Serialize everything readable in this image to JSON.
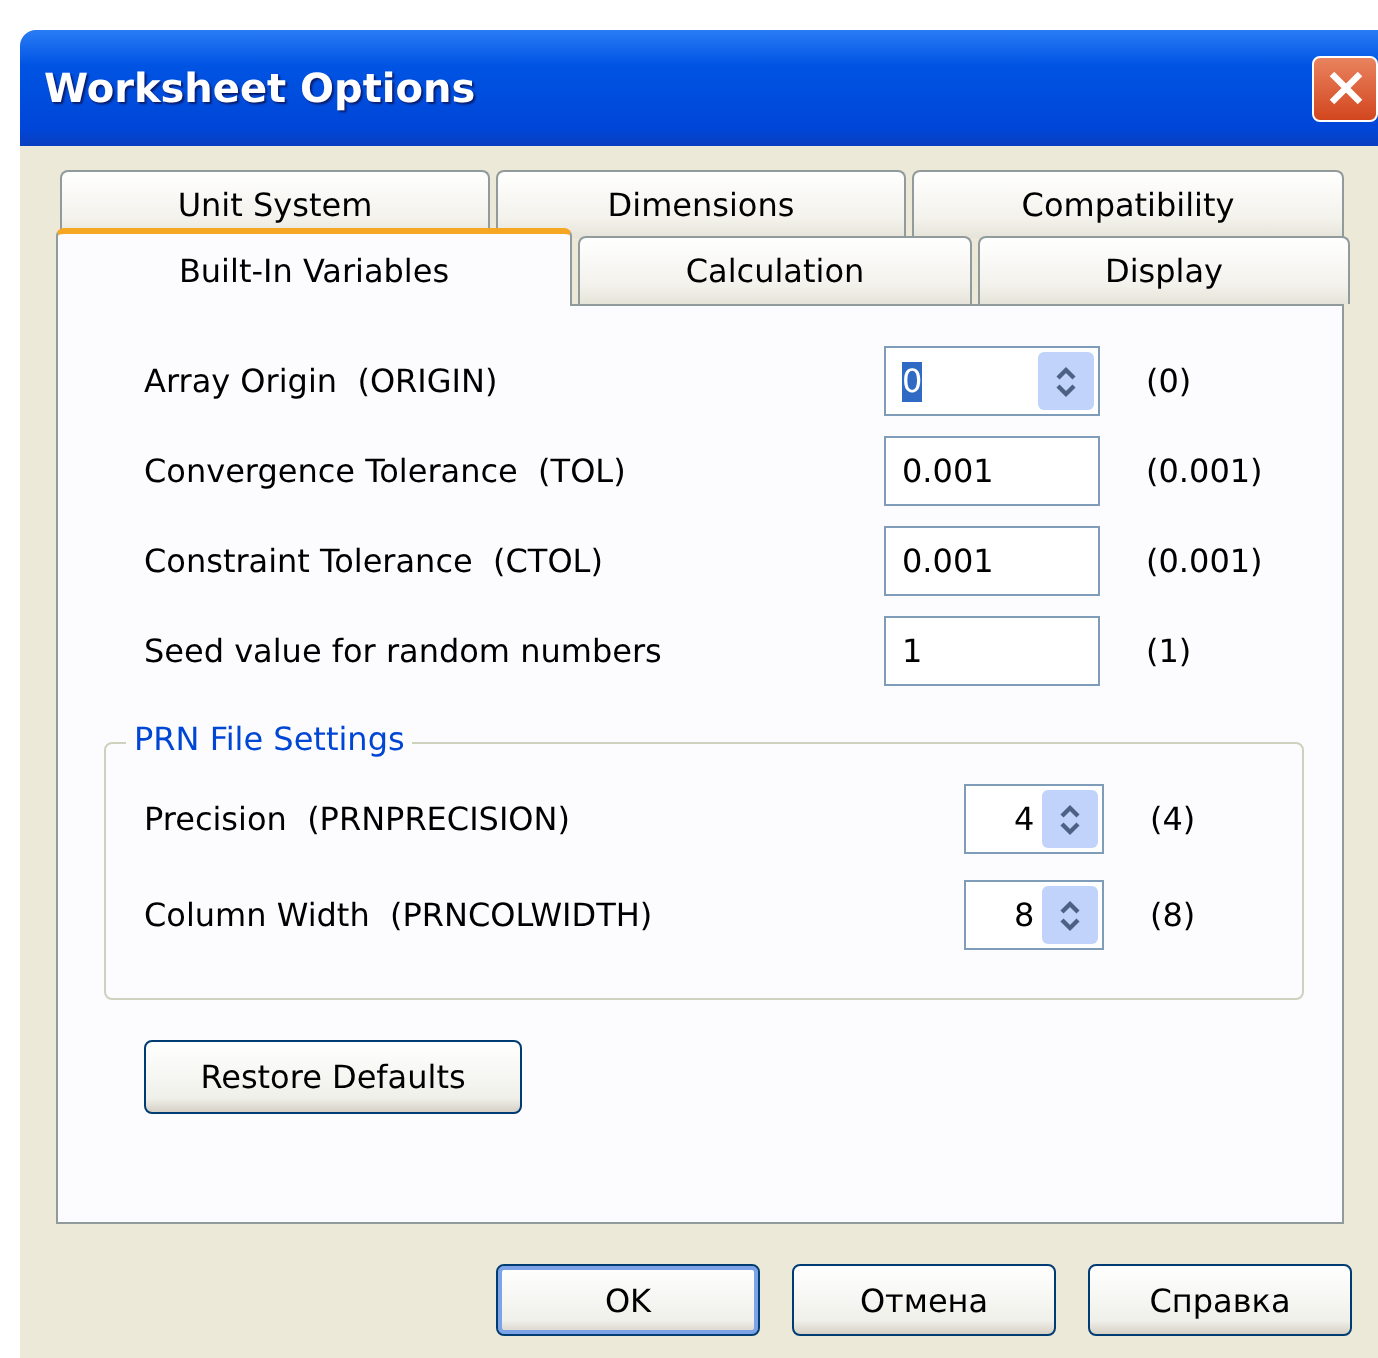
{
  "window": {
    "title": "Worksheet Options"
  },
  "tab_rows": [
    {
      "tabs": [
        {
          "label": "Unit System",
          "selected": false
        },
        {
          "label": "Dimensions",
          "selected": false
        },
        {
          "label": "Compatibility",
          "selected": false
        }
      ]
    },
    {
      "tabs": [
        {
          "label": "Built-In Variables",
          "selected": true
        },
        {
          "label": "Calculation",
          "selected": false
        },
        {
          "label": "Display",
          "selected": false
        }
      ]
    }
  ],
  "variables": [
    {
      "label": "Array Origin  (ORIGIN)",
      "kind": "spinner",
      "value": "0",
      "text_selected": true,
      "default": "(0)"
    },
    {
      "label": "Convergence Tolerance  (TOL)",
      "kind": "text",
      "value": "0.001",
      "text_selected": false,
      "default": "(0.001)"
    },
    {
      "label": "Constraint Tolerance  (CTOL)",
      "kind": "text",
      "value": "0.001",
      "text_selected": false,
      "default": "(0.001)"
    },
    {
      "label": "Seed value for random numbers",
      "kind": "text",
      "value": "1",
      "text_selected": false,
      "default": "(1)"
    }
  ],
  "prn_group": {
    "title": "PRN File Settings",
    "rows": [
      {
        "label": "Precision  (PRNPRECISION)",
        "kind": "spinner",
        "value": "4",
        "text_selected": false,
        "default": "(4)"
      },
      {
        "label": "Column Width  (PRNCOLWIDTH)",
        "kind": "spinner",
        "value": "8",
        "text_selected": false,
        "default": "(8)"
      }
    ]
  },
  "restore_button": "Restore Defaults",
  "buttons": [
    {
      "label": "OK",
      "default": true
    },
    {
      "label": "Отмена",
      "default": false
    },
    {
      "label": "Справка",
      "default": false
    }
  ]
}
